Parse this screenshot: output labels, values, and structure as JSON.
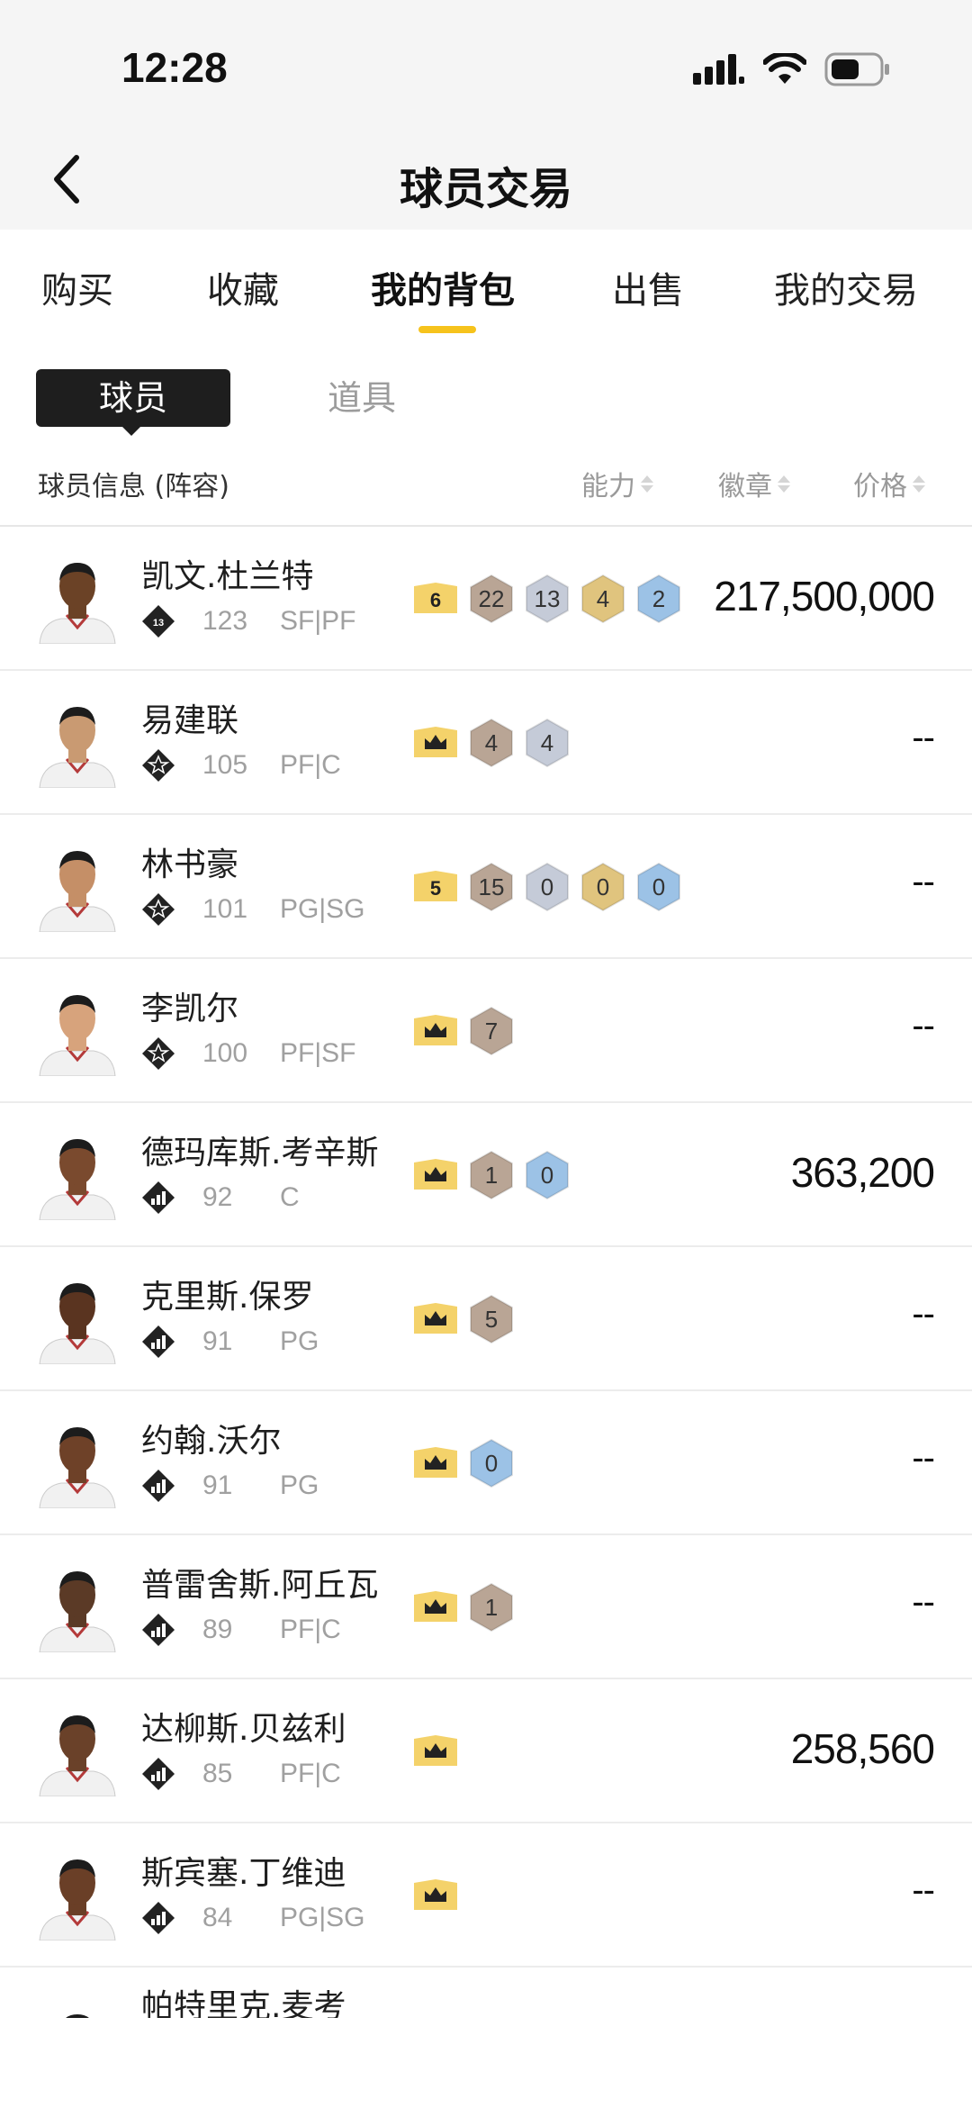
{
  "status": {
    "time": "12:28"
  },
  "nav": {
    "title": "球员交易",
    "back": "back-icon"
  },
  "tabs": [
    "购买",
    "收藏",
    "我的背包",
    "出售",
    "我的交易"
  ],
  "active_tab": 2,
  "segment": {
    "active": "球员",
    "inactive": "道具"
  },
  "columns": {
    "info": "球员信息 (阵容)",
    "ability": "能力",
    "badge": "徽章",
    "price": "价格"
  },
  "colors": {
    "accent": "#f6c31c",
    "bronze": "#b9a595",
    "silver": "#c5cbd8",
    "gold": "#e0c47e",
    "hof": "#9cc2e6"
  },
  "players": [
    {
      "name": "凯文.杜兰特",
      "ovr": "123",
      "pos": "SF|PF",
      "tag": "6",
      "badges": [
        [
          "bronze",
          "22"
        ],
        [
          "silver",
          "13"
        ],
        [
          "gold",
          "4"
        ],
        [
          "hof",
          "2"
        ]
      ],
      "price": "217,500,000"
    },
    {
      "name": "易建联",
      "ovr": "105",
      "pos": "PF|C",
      "tag": "crown",
      "badges": [
        [
          "bronze",
          "4"
        ],
        [
          "silver",
          "4"
        ]
      ],
      "price": "--"
    },
    {
      "name": "林书豪",
      "ovr": "101",
      "pos": "PG|SG",
      "tag": "5",
      "badges": [
        [
          "bronze",
          "15"
        ],
        [
          "silver",
          "0"
        ],
        [
          "gold",
          "0"
        ],
        [
          "hof",
          "0"
        ]
      ],
      "price": "--"
    },
    {
      "name": "李凯尔",
      "ovr": "100",
      "pos": "PF|SF",
      "tag": "crown",
      "badges": [
        [
          "bronze",
          "7"
        ]
      ],
      "price": "--"
    },
    {
      "name": "德玛库斯.考辛斯",
      "ovr": "92",
      "pos": "C",
      "tag": "crown",
      "badges": [
        [
          "bronze",
          "1"
        ],
        [
          "hof",
          "0"
        ]
      ],
      "price": "363,200"
    },
    {
      "name": "克里斯.保罗",
      "ovr": "91",
      "pos": "PG",
      "tag": "crown",
      "badges": [
        [
          "bronze",
          "5"
        ]
      ],
      "price": "--"
    },
    {
      "name": "约翰.沃尔",
      "ovr": "91",
      "pos": "PG",
      "tag": "crown",
      "badges": [
        [
          "hof",
          "0"
        ]
      ],
      "price": "--"
    },
    {
      "name": "普雷舍斯.阿丘瓦",
      "ovr": "89",
      "pos": "PF|C",
      "tag": "crown",
      "badges": [
        [
          "bronze",
          "1"
        ]
      ],
      "price": "--"
    },
    {
      "name": "达柳斯.贝兹利",
      "ovr": "85",
      "pos": "PF|C",
      "tag": "crown",
      "badges": [],
      "price": "258,560"
    },
    {
      "name": "斯宾塞.丁维迪",
      "ovr": "84",
      "pos": "PG|SG",
      "tag": "crown",
      "badges": [],
      "price": "--"
    }
  ],
  "partial_player": {
    "name": "帕特里克.麦考"
  }
}
